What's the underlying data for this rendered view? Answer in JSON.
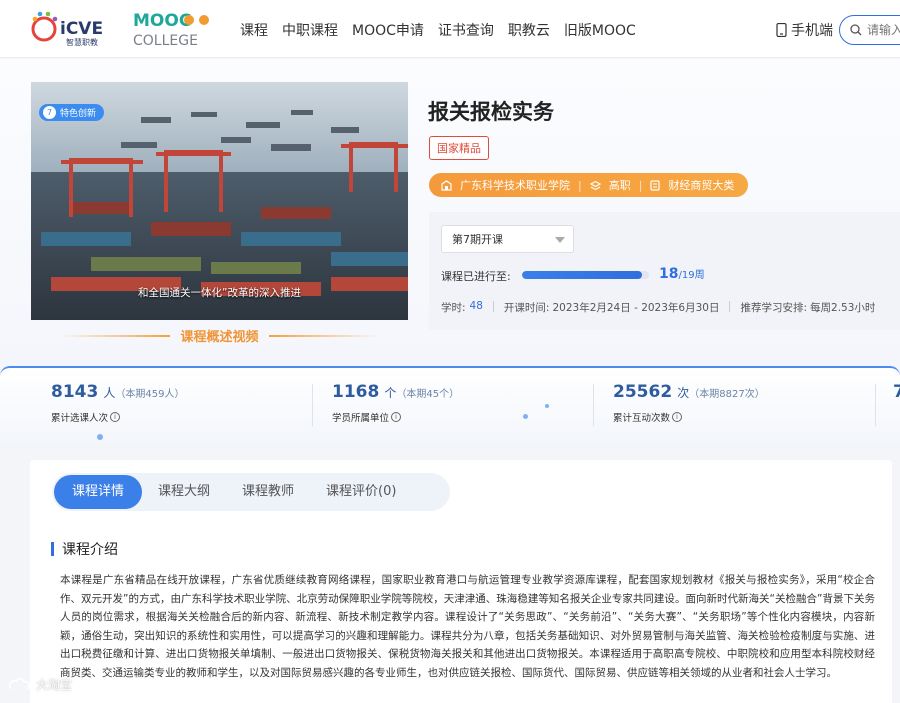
{
  "header": {
    "logo_icve_text": "iCVE",
    "logo_icve_sub": "智慧职教",
    "logo_mooc_text": "MOOC",
    "logo_mooc_sub": "COLLEGE",
    "nav": [
      "课程",
      "中职课程",
      "MOOC申请",
      "证书查询",
      "职教云",
      "旧版MOOC"
    ],
    "mobile_label": "手机端",
    "search_placeholder": "请输入"
  },
  "video": {
    "tag_num": "7",
    "tag_label": "特色创新",
    "caption": "和全国通关一体化”改革的深入推进",
    "label": "课程概述视频"
  },
  "course": {
    "title": "报关报检实务",
    "badge": "国家精品",
    "school": "广东科学技术职业学院",
    "level": "高职",
    "category": "财经商贸大类",
    "term": "第7期开课",
    "progress_label": "课程已进行至:",
    "progress_current": "18",
    "progress_total": "/19周",
    "progress_fraction": 0.947,
    "hours_label": "学时:",
    "hours_value": "48",
    "time_label": "开课时间:",
    "time_value": "2023年2月24日 - 2023年6月30日",
    "suggest_label": "推荐学习安排:",
    "suggest_value": "每周2.53小时"
  },
  "stats": [
    {
      "value": "8143",
      "unit": "人",
      "extra": "（本期459人）",
      "desc": "累计选课人次"
    },
    {
      "value": "1168",
      "unit": "个",
      "extra": "（本期45个）",
      "desc": "学员所属单位"
    },
    {
      "value": "25562",
      "unit": "次",
      "extra": "（本期8827次）",
      "desc": "累计互动次数"
    },
    {
      "value": "7",
      "unit": "",
      "extra": "",
      "desc": ""
    }
  ],
  "tabs": [
    "课程详情",
    "课程大纲",
    "课程教师",
    "课程评价(0)"
  ],
  "intro": {
    "title": "课程介绍",
    "body": "本课程是广东省精品在线开放课程，广东省优质继续教育网络课程，国家职业教育港口与航运管理专业教学资源库课程，配套国家规划教材《报关与报检实务》，采用“校企合作、双元开发”的方式，由广东科学技术职业学院、北京劳动保障职业学院等院校，天津津通、珠海稳建等知名报关企业专家共同建设。面向新时代新海关“关检融合”背景下关务人员的岗位需求，根据海关关检融合后的新内容、新流程、新技术制定教学内容。课程设计了“关务思政”、“关务前沿”、“关务大赛”、“关务职场”等个性化内容模块，内容新颖，通俗生动，突出知识的系统性和实用性，可以提高学习的兴趣和理解能力。课程共分为八章，包括关务基础知识、对外贸易管制与海关监管、海关检验检疫制度与实施、进出口税费征缴和计算、进出口货物报关单填制、一般进出口货物报关、保税货物海关报关和其他进出口货物报关。本课程适用于高职高专院校、中职院校和应用型本科院校财经商贸类、交通运输类专业的教师和学生，以及对国际贸易感兴趣的各专业师生，也对供应链关报检、国际货代、国际贸易、供应链等相关领域的从业者和社会人士学习。"
  },
  "watermark": "大淘宝"
}
